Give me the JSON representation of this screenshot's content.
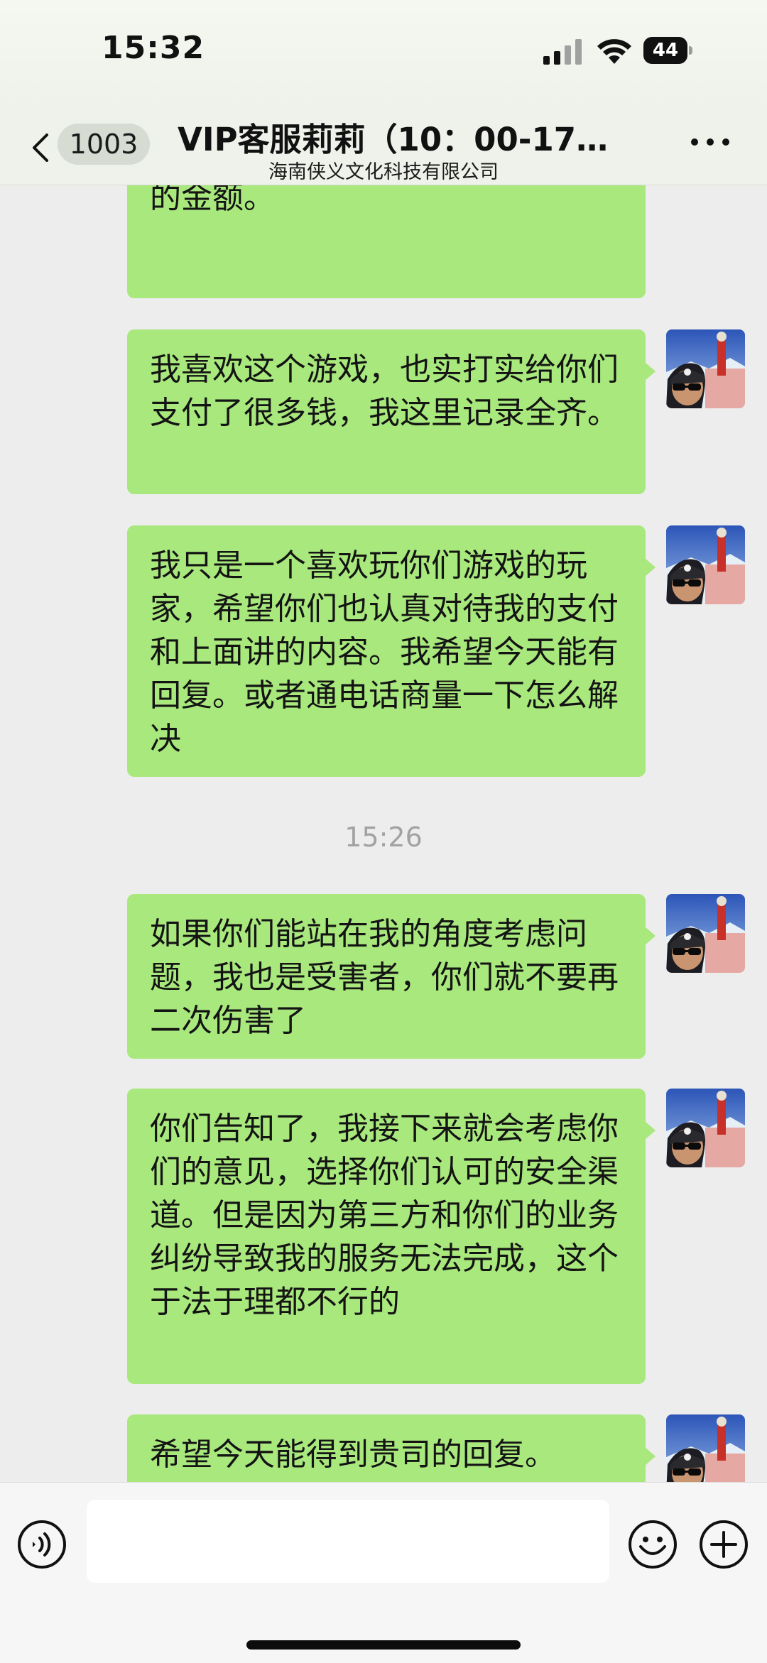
{
  "status_bar": {
    "time": "15:32",
    "battery": "44"
  },
  "header": {
    "back_count": "1003",
    "title": "VIP客服莉莉（10：00-17…",
    "subtitle": "海南侠义文化科技有限公司"
  },
  "messages": [
    {
      "type": "outgoing",
      "text": "时。如果你们不能处理，那么我会起诉，这个金额早已超过可以立案的金额。",
      "avatar": "user-avatar"
    },
    {
      "type": "outgoing",
      "text": "我喜欢这个游戏，也实打实给你们支付了很多钱，我这里记录全齐。",
      "avatar": "user-avatar"
    },
    {
      "type": "outgoing",
      "text": "我只是一个喜欢玩你们游戏的玩家，希望你们也认真对待我的支付和上面讲的内容。我希望今天能有回复。或者通电话商量一下怎么解决",
      "avatar": "user-avatar"
    },
    {
      "type": "timestamp",
      "text": "15:26"
    },
    {
      "type": "outgoing",
      "text": "如果你们能站在我的角度考虑问题，我也是受害者，你们就不要再二次伤害了",
      "avatar": "user-avatar"
    },
    {
      "type": "outgoing",
      "text": "你们告知了，我接下来就会考虑你们的意见，选择你们认可的安全渠道。但是因为第三方和你们的业务纠纷导致我的服务无法完成，这个于法于理都不行的",
      "avatar": "user-avatar"
    },
    {
      "type": "outgoing",
      "text": "希望今天能得到贵司的回复。",
      "avatar": "user-avatar"
    }
  ],
  "input_bar": {
    "message_value": "",
    "message_placeholder": ""
  },
  "colors": {
    "bubble": "#a8e87d",
    "background": "#ededed",
    "header": "#eef2ea"
  }
}
